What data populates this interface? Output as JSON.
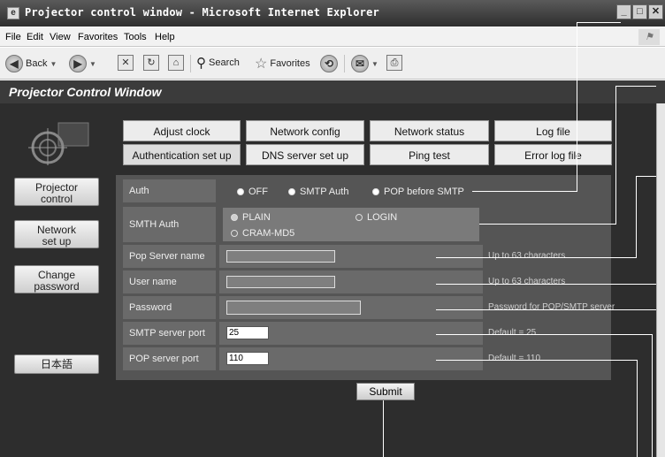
{
  "window": {
    "title": "Projector control window - Microsoft Internet Explorer"
  },
  "menu": {
    "items": [
      "File",
      "Edit",
      "View",
      "Favorites",
      "Tools",
      "Help"
    ]
  },
  "toolbar": {
    "back": "Back",
    "search": "Search",
    "favorites": "Favorites"
  },
  "page": {
    "title": "Projector Control Window"
  },
  "nav": {
    "projector_control": [
      "Projector",
      "control"
    ],
    "network_setup": [
      "Network",
      "set up"
    ],
    "change_password": [
      "Change",
      "password"
    ],
    "japanese": "日本語"
  },
  "tabs": {
    "row1": [
      "Adjust clock",
      "Network config",
      "Network status",
      "Log file"
    ],
    "row2": [
      "Authentication set up",
      "DNS server set up",
      "Ping test",
      "Error log file"
    ],
    "active": "Authentication set up"
  },
  "form": {
    "auth": {
      "label": "Auth",
      "options": [
        "OFF",
        "SMTP Auth",
        "POP before SMTP"
      ],
      "selected": "OFF"
    },
    "smth_auth": {
      "label": "SMTH Auth",
      "options": [
        "PLAIN",
        "LOGIN",
        "CRAM-MD5"
      ],
      "selected": "PLAIN"
    },
    "pop_server": {
      "label": "Pop Server name",
      "value": "",
      "hint": "Up to 63 characters"
    },
    "user_name": {
      "label": "User name",
      "value": "",
      "hint": "Up to 63 characters"
    },
    "password": {
      "label": "Password",
      "value": "",
      "hint": "Password for POP/SMTP server"
    },
    "smtp_port": {
      "label": "SMTP server port",
      "value": "25",
      "hint": "Default = 25"
    },
    "pop_port": {
      "label": "POP server port",
      "value": "110",
      "hint": "Default = 110"
    },
    "submit": "Submit"
  }
}
